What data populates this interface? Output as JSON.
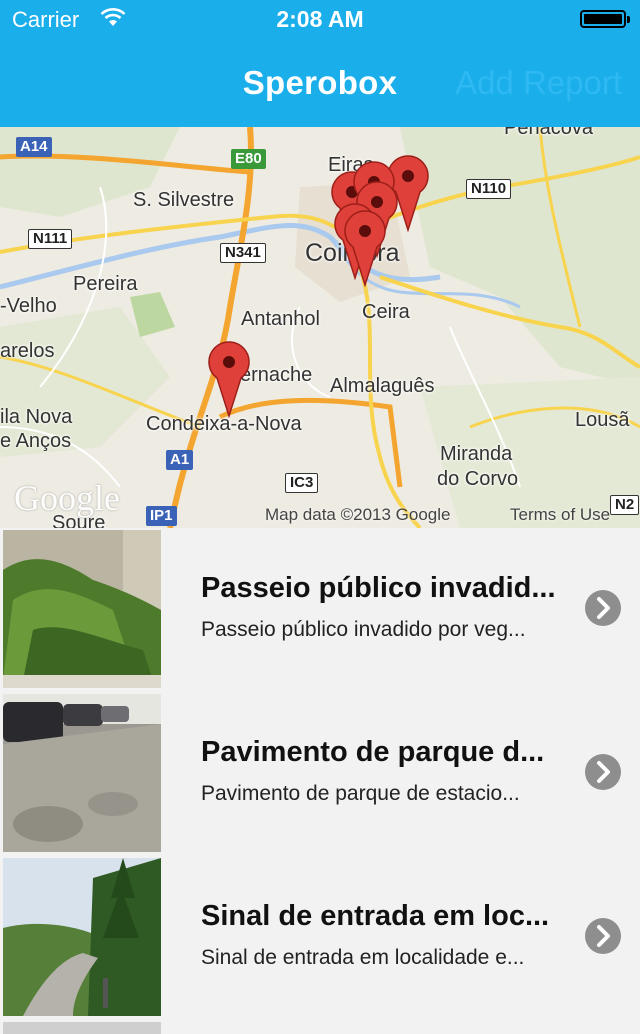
{
  "status": {
    "carrier": "Carrier",
    "time": "2:08 AM"
  },
  "nav": {
    "title": "Sperobox",
    "right_button": "Add Report"
  },
  "map": {
    "labels": {
      "s_silvestre": "S. Silvestre",
      "coimbra": "Coimbra",
      "pereira": "Pereira",
      "velho": "-Velho",
      "arelos": "arelos",
      "antanhol": "Antanhol",
      "ceira": "Ceira",
      "ila_nova": "ila Nova",
      "e_ancos": "e Anços",
      "ernache": "ernache",
      "almalaguês": "Almalaguês",
      "condeixa": "Condeixa-a-Nova",
      "lousa": "Lousã",
      "miranda": "Miranda",
      "do_corvo": "do Corvo",
      "penacova": "Penacova",
      "eiras": "Eiras",
      "soure": "Soure"
    },
    "roads": {
      "a14": "A14",
      "e80": "E80",
      "n111": "N111",
      "n341": "N341",
      "n110": "N110",
      "a1": "A1",
      "ic3": "IC3",
      "ip1": "IP1",
      "n2": "N2"
    },
    "google_logo": "Google",
    "attribution": "Map data ©2013 Google",
    "terms": "Terms of Use"
  },
  "reports": [
    {
      "title": "Passeio público invadid...",
      "subtitle": "Passeio público invadido por veg..."
    },
    {
      "title": "Pavimento de parque d...",
      "subtitle": "Pavimento de parque de estacio..."
    },
    {
      "title": "Sinal de entrada em loc...",
      "subtitle": "Sinal de entrada em localidade e..."
    }
  ],
  "icons": {
    "wifi": "wifi-icon",
    "battery": "battery-icon",
    "pin": "map-pin-icon",
    "chevron": "chevron-right-icon"
  },
  "colors": {
    "nav_bar": "#1aaeeb",
    "pin": "#e0403a",
    "chevron": "#8e8e8e"
  }
}
